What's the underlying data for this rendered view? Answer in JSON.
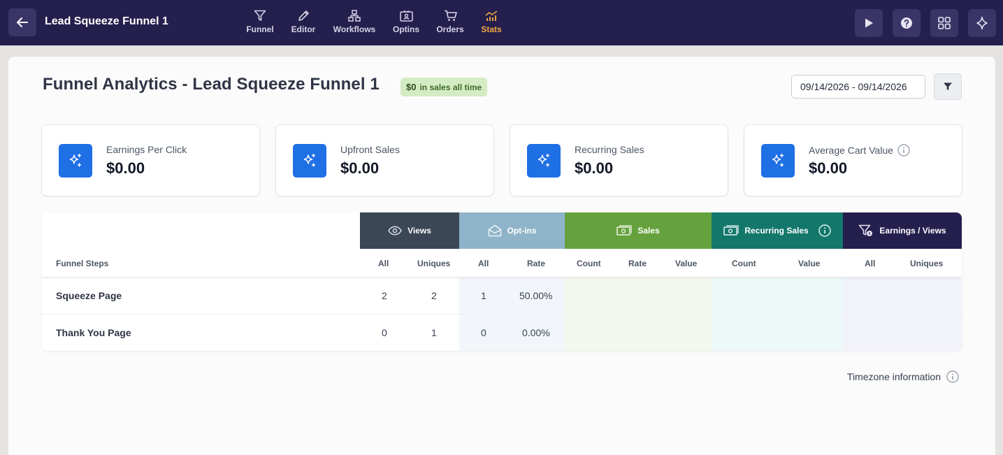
{
  "header": {
    "title": "Lead Squeeze Funnel 1",
    "nav": [
      {
        "label": "Funnel",
        "icon": "funnel-icon"
      },
      {
        "label": "Editor",
        "icon": "pencil-icon"
      },
      {
        "label": "Workflows",
        "icon": "workflow-icon"
      },
      {
        "label": "Optins",
        "icon": "contact-card-icon"
      },
      {
        "label": "Orders",
        "icon": "cart-icon"
      },
      {
        "label": "Stats",
        "icon": "stats-icon",
        "active": true
      }
    ],
    "actions": [
      "play-icon",
      "help-icon",
      "grid-icon",
      "sparkle-icon"
    ]
  },
  "page": {
    "title": "Funnel Analytics - Lead Squeeze Funnel 1",
    "badge_amount": "$0",
    "badge_text": "in sales all time",
    "date_range": "09/14/2026 - 09/14/2026"
  },
  "stats": [
    {
      "label": "Earnings Per Click",
      "value": "$0.00"
    },
    {
      "label": "Upfront Sales",
      "value": "$0.00"
    },
    {
      "label": "Recurring Sales",
      "value": "$0.00"
    },
    {
      "label": "Average Cart Value",
      "value": "$0.00",
      "info": true
    }
  ],
  "table": {
    "groups": {
      "views": "Views",
      "optins": "Opt-ins",
      "sales": "Sales",
      "recurring": "Recurring Sales",
      "earnings": "Earnings / Views"
    },
    "columns": {
      "steps": "Funnel Steps",
      "views_all": "All",
      "views_uniques": "Uniques",
      "optins_all": "All",
      "optins_rate": "Rate",
      "sales_count": "Count",
      "sales_rate": "Rate",
      "sales_value": "Value",
      "rec_count": "Count",
      "rec_value": "Value",
      "earn_all": "All",
      "earn_uniques": "Uniques"
    },
    "rows": [
      {
        "name": "Squeeze Page",
        "views_all": "2",
        "views_uniques": "2",
        "optins_all": "1",
        "optins_rate": "50.00%"
      },
      {
        "name": "Thank You Page",
        "views_all": "0",
        "views_uniques": "1",
        "optins_all": "0",
        "optins_rate": "0.00%"
      }
    ]
  },
  "footer": {
    "timezone": "Timezone information"
  },
  "colors": {
    "topbar": "#241f4d",
    "active_nav": "#f4a742",
    "views": "#3b4656",
    "optins": "#8fb4c9",
    "sales": "#65a13d",
    "recurring": "#14776b",
    "earnings": "#241f4d",
    "stat_icon": "#1f6fe5"
  }
}
